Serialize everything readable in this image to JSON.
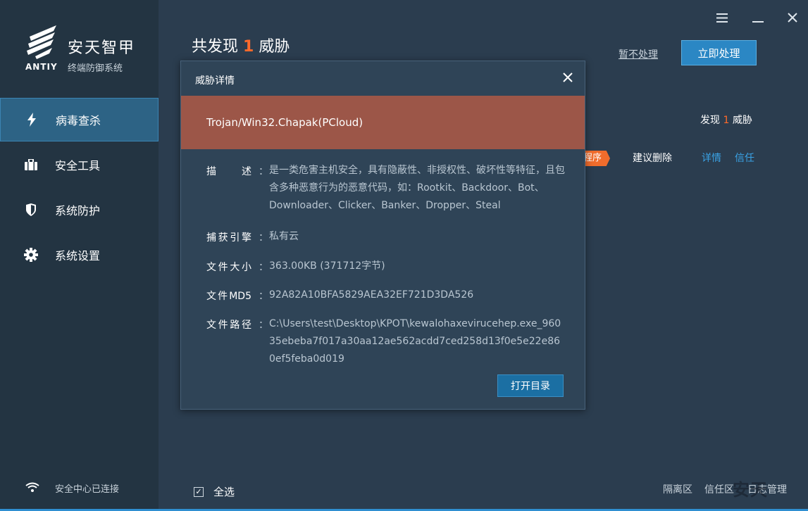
{
  "brand": {
    "name": "安天智甲",
    "latin": "ANTIY",
    "subtitle": "终端防御系统"
  },
  "sidebar": {
    "items": [
      {
        "label": "病毒查杀",
        "icon": "lightning-icon",
        "active": true
      },
      {
        "label": "安全工具",
        "icon": "briefcase-icon",
        "active": false
      },
      {
        "label": "系统防护",
        "icon": "shield-icon",
        "active": false
      },
      {
        "label": "系统设置",
        "icon": "gear-icon",
        "active": false
      }
    ],
    "status": "安全中心已连接"
  },
  "header": {
    "title_prefix": "共发现",
    "threat_count": "1",
    "title_suffix": "威胁",
    "ignore_label": "暂不处理",
    "handle_label": "立即处理"
  },
  "summary": {
    "prefix": "发现",
    "count": "1",
    "suffix": "威胁"
  },
  "threat_row": {
    "tag": "程序",
    "suggestion": "建议删除",
    "details_link": "详情",
    "trust_link": "信任"
  },
  "footer": {
    "select_all": "全选",
    "checked": true,
    "links": [
      "隔离区",
      "信任区",
      "日志管理"
    ],
    "watermark": "安天"
  },
  "dialog": {
    "title": "威胁详情",
    "threat_name": "Trojan/Win32.Chapak(PCloud)",
    "rows": [
      {
        "label": "描　述",
        "value": "是一类危害主机安全，具有隐蔽性、非授权性、破坏性等特征，且包含多种恶意行为的恶意代码，如：Rootkit、Backdoor、Bot、Downloader、Clicker、Banker、Dropper、Steal"
      },
      {
        "label": "捕获引擎",
        "value": "私有云"
      },
      {
        "label": "文件大小",
        "value": "363.00KB (371712字节)"
      },
      {
        "label": "文件MD5",
        "value": "92A82A10BFA5829AEA32EF721D3DA526"
      },
      {
        "label": "文件路径",
        "value": "C:\\Users\\test\\Desktop\\KPOT\\kewalohaxevirucehep.exe_96035ebeba7f017a30aa12ae562acdd7ced258d13f0e5e22e860ef5feba0d019"
      }
    ],
    "open_dir_label": "打开目录"
  },
  "colors": {
    "accent": "#2b87c4",
    "threat_red": "#ff6a2b",
    "banner": "#9c5648",
    "link": "#3aa3e6"
  }
}
